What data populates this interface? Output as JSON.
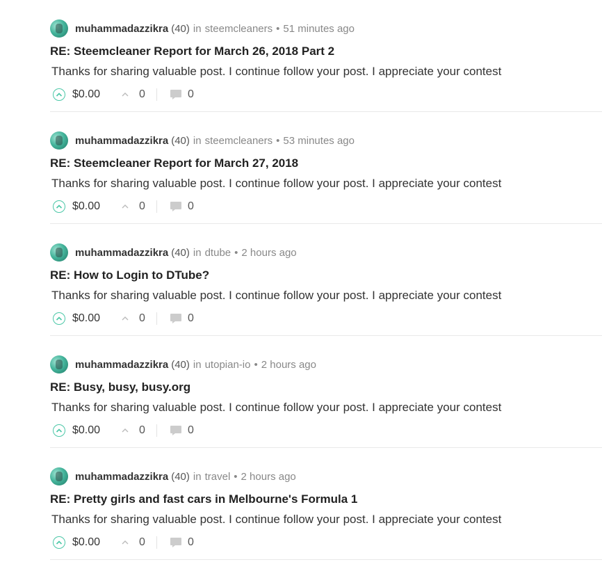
{
  "colors": {
    "accent": "#4bc7a7",
    "muted": "#888888",
    "text": "#333333"
  },
  "posts": [
    {
      "author": "muhammadazzikra",
      "rep": "(40)",
      "in_label": "in",
      "community": "steemcleaners",
      "separator": "•",
      "time": "51 minutes ago",
      "title": "RE: Steemcleaner Report for March 26, 2018 Part 2",
      "body": "Thanks for sharing valuable post. I continue follow your post. I appreciate your contest",
      "payout": "$0.00",
      "votes": "0",
      "comments": "0"
    },
    {
      "author": "muhammadazzikra",
      "rep": "(40)",
      "in_label": "in",
      "community": "steemcleaners",
      "separator": "•",
      "time": "53 minutes ago",
      "title": "RE: Steemcleaner Report for March 27, 2018",
      "body": "Thanks for sharing valuable post. I continue follow your post. I appreciate your contest",
      "payout": "$0.00",
      "votes": "0",
      "comments": "0"
    },
    {
      "author": "muhammadazzikra",
      "rep": "(40)",
      "in_label": "in",
      "community": "dtube",
      "separator": "•",
      "time": "2 hours ago",
      "title": "RE: How to Login to DTube?",
      "body": "Thanks for sharing valuable post. I continue follow your post. I appreciate your contest",
      "payout": "$0.00",
      "votes": "0",
      "comments": "0"
    },
    {
      "author": "muhammadazzikra",
      "rep": "(40)",
      "in_label": "in",
      "community": "utopian-io",
      "separator": "•",
      "time": "2 hours ago",
      "title": "RE: Busy, busy, busy.org",
      "body": "Thanks for sharing valuable post. I continue follow your post. I appreciate your contest",
      "payout": "$0.00",
      "votes": "0",
      "comments": "0"
    },
    {
      "author": "muhammadazzikra",
      "rep": "(40)",
      "in_label": "in",
      "community": "travel",
      "separator": "•",
      "time": "2 hours ago",
      "title": "RE: Pretty girls and fast cars in Melbourne's Formula 1",
      "body": "Thanks for sharing valuable post. I continue follow your post. I appreciate your contest",
      "payout": "$0.00",
      "votes": "0",
      "comments": "0"
    }
  ]
}
